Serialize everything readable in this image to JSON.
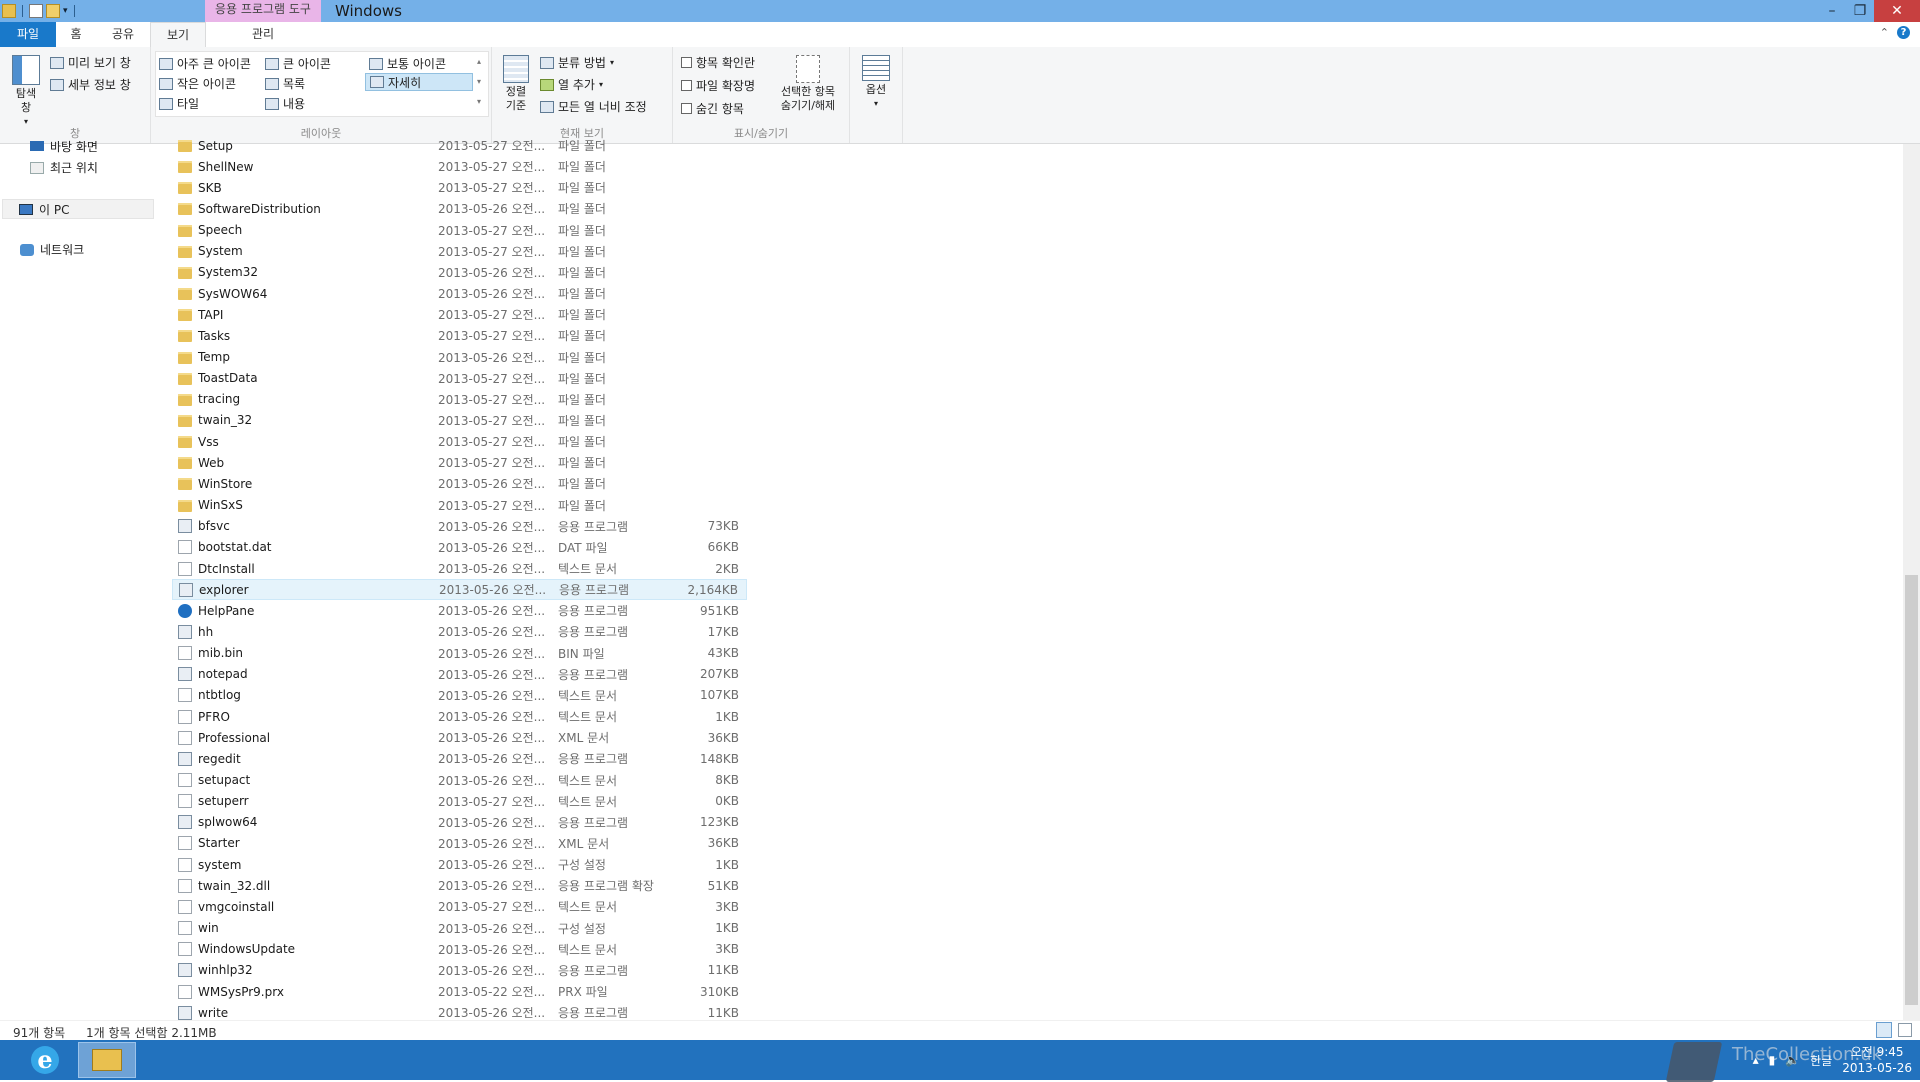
{
  "window": {
    "title": "Windows",
    "contextual_header": "응용 프로그램 도구"
  },
  "tabs": {
    "file": "파일",
    "home": "홈",
    "share": "공유",
    "view": "보기",
    "manage": "관리"
  },
  "ribbon": {
    "pane": {
      "nav_pane": "탐색\n창",
      "preview": "미리 보기 창",
      "details": "세부 정보 창",
      "label": "창"
    },
    "layout": {
      "extra_large": "아주 큰 아이콘",
      "large": "큰 아이콘",
      "medium": "보통 아이콘",
      "small": "작은 아이콘",
      "list": "목록",
      "details": "자세히",
      "tiles": "타일",
      "content": "내용",
      "label": "레이아웃"
    },
    "current_view": {
      "sort_by": "정렬\n기준",
      "group_by": "분류 방법",
      "add_columns": "열 추가",
      "size_all": "모든 열 너비 조정",
      "label": "현재 보기"
    },
    "show_hide": {
      "checkboxes": "항목 확인란",
      "extensions": "파일 확장명",
      "hidden": "숨긴 항목",
      "hide_selected": "선택한 항목\n숨기기/해제",
      "label": "표시/숨기기"
    },
    "options": "옵션"
  },
  "nav": {
    "desktop_partial": "바탕 화면",
    "recent": "최근 위치",
    "this_pc": "이 PC",
    "network": "네트워크"
  },
  "files": [
    {
      "name": "Setup",
      "date": "2013-05-27 오전...",
      "type": "파일 폴더",
      "size": "",
      "icon": "folder"
    },
    {
      "name": "ShellNew",
      "date": "2013-05-27 오전...",
      "type": "파일 폴더",
      "size": "",
      "icon": "folder"
    },
    {
      "name": "SKB",
      "date": "2013-05-27 오전...",
      "type": "파일 폴더",
      "size": "",
      "icon": "folder"
    },
    {
      "name": "SoftwareDistribution",
      "date": "2013-05-26 오전...",
      "type": "파일 폴더",
      "size": "",
      "icon": "folder"
    },
    {
      "name": "Speech",
      "date": "2013-05-27 오전...",
      "type": "파일 폴더",
      "size": "",
      "icon": "folder"
    },
    {
      "name": "System",
      "date": "2013-05-27 오전...",
      "type": "파일 폴더",
      "size": "",
      "icon": "folder"
    },
    {
      "name": "System32",
      "date": "2013-05-26 오전...",
      "type": "파일 폴더",
      "size": "",
      "icon": "folder"
    },
    {
      "name": "SysWOW64",
      "date": "2013-05-26 오전...",
      "type": "파일 폴더",
      "size": "",
      "icon": "folder"
    },
    {
      "name": "TAPI",
      "date": "2013-05-27 오전...",
      "type": "파일 폴더",
      "size": "",
      "icon": "folder"
    },
    {
      "name": "Tasks",
      "date": "2013-05-27 오전...",
      "type": "파일 폴더",
      "size": "",
      "icon": "folder"
    },
    {
      "name": "Temp",
      "date": "2013-05-26 오전...",
      "type": "파일 폴더",
      "size": "",
      "icon": "folder"
    },
    {
      "name": "ToastData",
      "date": "2013-05-27 오전...",
      "type": "파일 폴더",
      "size": "",
      "icon": "folder"
    },
    {
      "name": "tracing",
      "date": "2013-05-27 오전...",
      "type": "파일 폴더",
      "size": "",
      "icon": "folder"
    },
    {
      "name": "twain_32",
      "date": "2013-05-27 오전...",
      "type": "파일 폴더",
      "size": "",
      "icon": "folder"
    },
    {
      "name": "Vss",
      "date": "2013-05-27 오전...",
      "type": "파일 폴더",
      "size": "",
      "icon": "folder"
    },
    {
      "name": "Web",
      "date": "2013-05-27 오전...",
      "type": "파일 폴더",
      "size": "",
      "icon": "folder"
    },
    {
      "name": "WinStore",
      "date": "2013-05-26 오전...",
      "type": "파일 폴더",
      "size": "",
      "icon": "folder"
    },
    {
      "name": "WinSxS",
      "date": "2013-05-27 오전...",
      "type": "파일 폴더",
      "size": "",
      "icon": "folder"
    },
    {
      "name": "bfsvc",
      "date": "2013-05-26 오전...",
      "type": "응용 프로그램",
      "size": "73KB",
      "icon": "exe"
    },
    {
      "name": "bootstat.dat",
      "date": "2013-05-26 오전...",
      "type": "DAT 파일",
      "size": "66KB",
      "icon": "txt"
    },
    {
      "name": "DtcInstall",
      "date": "2013-05-26 오전...",
      "type": "텍스트 문서",
      "size": "2KB",
      "icon": "txt"
    },
    {
      "name": "explorer",
      "date": "2013-05-26 오전...",
      "type": "응용 프로그램",
      "size": "2,164KB",
      "icon": "exe",
      "selected": true
    },
    {
      "name": "HelpPane",
      "date": "2013-05-26 오전...",
      "type": "응용 프로그램",
      "size": "951KB",
      "icon": "help"
    },
    {
      "name": "hh",
      "date": "2013-05-26 오전...",
      "type": "응용 프로그램",
      "size": "17KB",
      "icon": "exe"
    },
    {
      "name": "mib.bin",
      "date": "2013-05-26 오전...",
      "type": "BIN 파일",
      "size": "43KB",
      "icon": "txt"
    },
    {
      "name": "notepad",
      "date": "2013-05-26 오전...",
      "type": "응용 프로그램",
      "size": "207KB",
      "icon": "exe"
    },
    {
      "name": "ntbtlog",
      "date": "2013-05-26 오전...",
      "type": "텍스트 문서",
      "size": "107KB",
      "icon": "txt"
    },
    {
      "name": "PFRO",
      "date": "2013-05-26 오전...",
      "type": "텍스트 문서",
      "size": "1KB",
      "icon": "txt"
    },
    {
      "name": "Professional",
      "date": "2013-05-26 오전...",
      "type": "XML 문서",
      "size": "36KB",
      "icon": "txt"
    },
    {
      "name": "regedit",
      "date": "2013-05-26 오전...",
      "type": "응용 프로그램",
      "size": "148KB",
      "icon": "exe"
    },
    {
      "name": "setupact",
      "date": "2013-05-26 오전...",
      "type": "텍스트 문서",
      "size": "8KB",
      "icon": "txt"
    },
    {
      "name": "setuperr",
      "date": "2013-05-27 오전...",
      "type": "텍스트 문서",
      "size": "0KB",
      "icon": "txt"
    },
    {
      "name": "splwow64",
      "date": "2013-05-26 오전...",
      "type": "응용 프로그램",
      "size": "123KB",
      "icon": "exe"
    },
    {
      "name": "Starter",
      "date": "2013-05-26 오전...",
      "type": "XML 문서",
      "size": "36KB",
      "icon": "txt"
    },
    {
      "name": "system",
      "date": "2013-05-26 오전...",
      "type": "구성 설정",
      "size": "1KB",
      "icon": "txt"
    },
    {
      "name": "twain_32.dll",
      "date": "2013-05-26 오전...",
      "type": "응용 프로그램 확장",
      "size": "51KB",
      "icon": "txt"
    },
    {
      "name": "vmgcoinstall",
      "date": "2013-05-27 오전...",
      "type": "텍스트 문서",
      "size": "3KB",
      "icon": "txt"
    },
    {
      "name": "win",
      "date": "2013-05-26 오전...",
      "type": "구성 설정",
      "size": "1KB",
      "icon": "txt"
    },
    {
      "name": "WindowsUpdate",
      "date": "2013-05-26 오전...",
      "type": "텍스트 문서",
      "size": "3KB",
      "icon": "txt"
    },
    {
      "name": "winhlp32",
      "date": "2013-05-26 오전...",
      "type": "응용 프로그램",
      "size": "11KB",
      "icon": "exe"
    },
    {
      "name": "WMSysPr9.prx",
      "date": "2013-05-22 오전...",
      "type": "PRX 파일",
      "size": "310KB",
      "icon": "txt"
    },
    {
      "name": "write",
      "date": "2013-05-26 오전...",
      "type": "응용 프로그램",
      "size": "11KB",
      "icon": "exe"
    }
  ],
  "status": {
    "count": "91개 항목",
    "selection": "1개 항목 선택함 2.11MB"
  },
  "taskbar": {
    "ime": "한글",
    "time": "오전 9:45",
    "date": "2013-05-26",
    "watermark": "TheCollection.uk"
  }
}
